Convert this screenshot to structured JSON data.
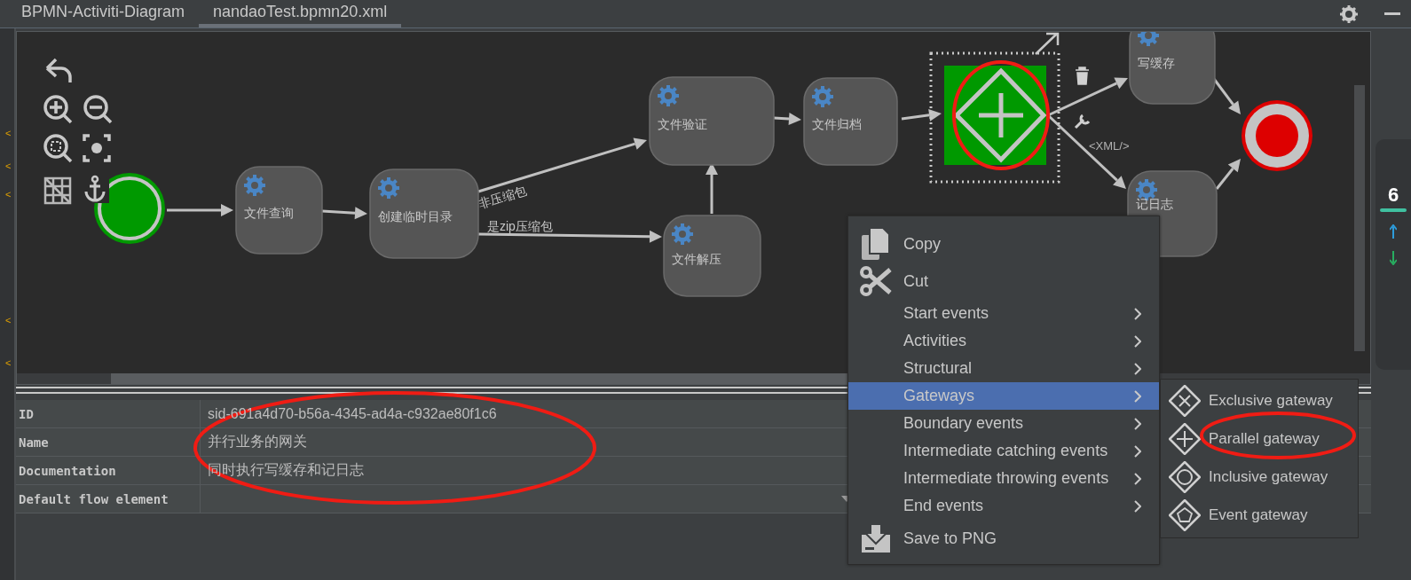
{
  "tabs": [
    {
      "label": "BPMN-Activiti-Diagram",
      "selected": false
    },
    {
      "label": "nandaoTest.bpmn20.xml",
      "selected": true
    }
  ],
  "gutter_marks": [
    "<",
    "<",
    "<",
    "<",
    "<"
  ],
  "diagram": {
    "nodes": [
      {
        "kind": "start"
      },
      {
        "kind": "task",
        "label": "文件查询"
      },
      {
        "kind": "task",
        "label": "创建临时目录"
      },
      {
        "kind": "task",
        "label": "文件验证"
      },
      {
        "kind": "task",
        "label": "文件解压"
      },
      {
        "kind": "task",
        "label": "文件归档"
      },
      {
        "kind": "gateway",
        "selected": true
      },
      {
        "kind": "task",
        "label": "写缓存"
      },
      {
        "kind": "task",
        "label": "记日志"
      },
      {
        "kind": "end"
      }
    ],
    "flow_labels": [
      "非压缩包",
      "是zip压缩包"
    ],
    "xml_label": "<XML/>"
  },
  "side_widget": {
    "text": "6"
  },
  "properties": [
    {
      "label": "ID",
      "value": "sid-691a4d70-b56a-4345-ad4a-c932ae80f1c6"
    },
    {
      "label": "Name",
      "value": "并行业务的网关"
    },
    {
      "label": "Documentation",
      "value": "同时执行写缓存和记日志"
    },
    {
      "label": "Default flow element",
      "kind": "dropdown"
    }
  ],
  "context_menu": [
    {
      "label": "Copy",
      "kind": "action",
      "selected": false
    },
    {
      "label": "Cut",
      "kind": "action",
      "selected": false
    },
    {
      "label": "Start events",
      "kind": "submenu",
      "selected": false
    },
    {
      "label": "Activities",
      "kind": "submenu",
      "selected": false
    },
    {
      "label": "Structural",
      "kind": "submenu",
      "selected": false
    },
    {
      "label": "Gateways",
      "kind": "submenu",
      "selected": true
    },
    {
      "label": "Boundary events",
      "kind": "submenu",
      "selected": false
    },
    {
      "label": "Intermediate catching events",
      "kind": "submenu",
      "selected": false
    },
    {
      "label": "Intermediate throwing events",
      "kind": "submenu",
      "selected": false
    },
    {
      "label": "End events",
      "kind": "submenu",
      "selected": false
    },
    {
      "label": "Save to PNG",
      "kind": "action",
      "selected": false
    }
  ],
  "submenu": [
    {
      "label": "Exclusive gateway"
    },
    {
      "label": "Parallel gateway"
    },
    {
      "label": "Inclusive gateway"
    },
    {
      "label": "Event gateway"
    }
  ]
}
